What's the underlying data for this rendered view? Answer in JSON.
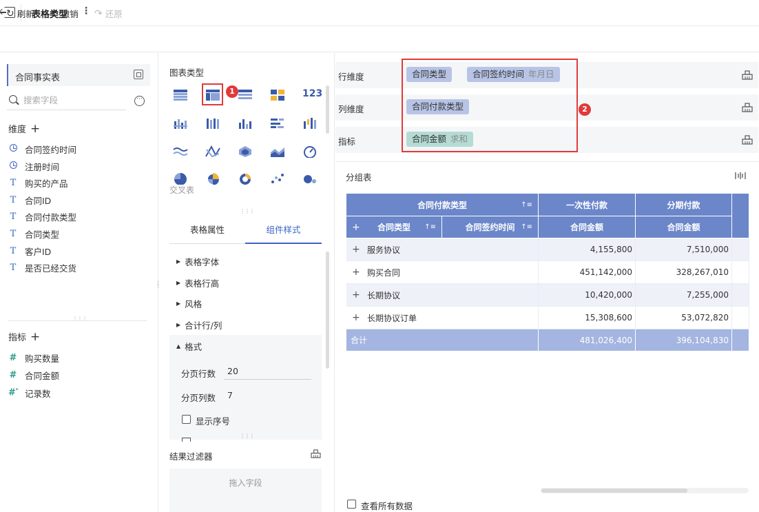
{
  "header": {
    "title": "表格类型",
    "menu_glyph": "⋮"
  },
  "toolbar": {
    "refresh": "刷新",
    "undo": "撤销",
    "redo": "还原"
  },
  "data_panel": {
    "table_name": "合同事实表",
    "search_placeholder": "搜索字段",
    "dimensions_title": "维度",
    "dimensions": [
      {
        "label": "合同签约时间",
        "type": "time"
      },
      {
        "label": "注册时间",
        "type": "time"
      },
      {
        "label": "购买的产品",
        "type": "text"
      },
      {
        "label": "合同ID",
        "type": "text"
      },
      {
        "label": "合同付款类型",
        "type": "text"
      },
      {
        "label": "合同类型",
        "type": "text"
      },
      {
        "label": "客户ID",
        "type": "text"
      },
      {
        "label": "是否已经交货",
        "type": "text"
      }
    ],
    "measures_title": "指标",
    "measures": [
      {
        "label": "购买数量",
        "type": "number"
      },
      {
        "label": "合同金额",
        "type": "number"
      },
      {
        "label": "记录数",
        "type": "count"
      }
    ]
  },
  "chart_panel": {
    "title": "图表类型",
    "selected_caption": "交叉表",
    "selected_index": 1,
    "badge1": "1",
    "badge2": "2",
    "big_number_glyph": "123"
  },
  "style_tabs": {
    "props": "表格属性",
    "style": "组件样式"
  },
  "style_sections": [
    "表格字体",
    "表格行高",
    "风格",
    "合计行/列",
    "格式"
  ],
  "format": {
    "page_rows_label": "分页行数",
    "page_rows": "20",
    "page_cols_label": "分页列数",
    "page_cols": "7",
    "show_seq_label": "显示序号"
  },
  "filter": {
    "title": "结果过滤器",
    "drop_hint": "拖入字段"
  },
  "shelves": {
    "row_label": "行维度",
    "col_label": "列维度",
    "measure_label": "指标",
    "row_pills": [
      {
        "label": "合同类型"
      },
      {
        "label": "合同签约时间",
        "sub": "年月日"
      }
    ],
    "col_pills": [
      {
        "label": "合同付款类型"
      }
    ],
    "measure_pills": [
      {
        "label": "合同金额",
        "sub": "求和"
      }
    ]
  },
  "table": {
    "card_title": "分组表",
    "header_payment_type": "合同付款类型",
    "col_one_time": "一次性付款",
    "col_installment": "分期付款",
    "header_contract_type": "合同类型",
    "header_sign_time": "合同签约时间",
    "measure_header": "合同金额",
    "rows": [
      {
        "name": "服务协议",
        "one_time": "4,155,800",
        "installment": "7,510,000"
      },
      {
        "name": "购买合同",
        "one_time": "451,142,000",
        "installment": "328,267,010"
      },
      {
        "name": "长期协议",
        "one_time": "10,420,000",
        "installment": "7,255,000"
      },
      {
        "name": "长期协议订单",
        "one_time": "15,308,600",
        "installment": "53,072,820"
      }
    ],
    "total_label": "合计",
    "total_one_time": "481,026,400",
    "total_installment": "396,104,830",
    "view_all_label": "查看所有数据"
  }
}
